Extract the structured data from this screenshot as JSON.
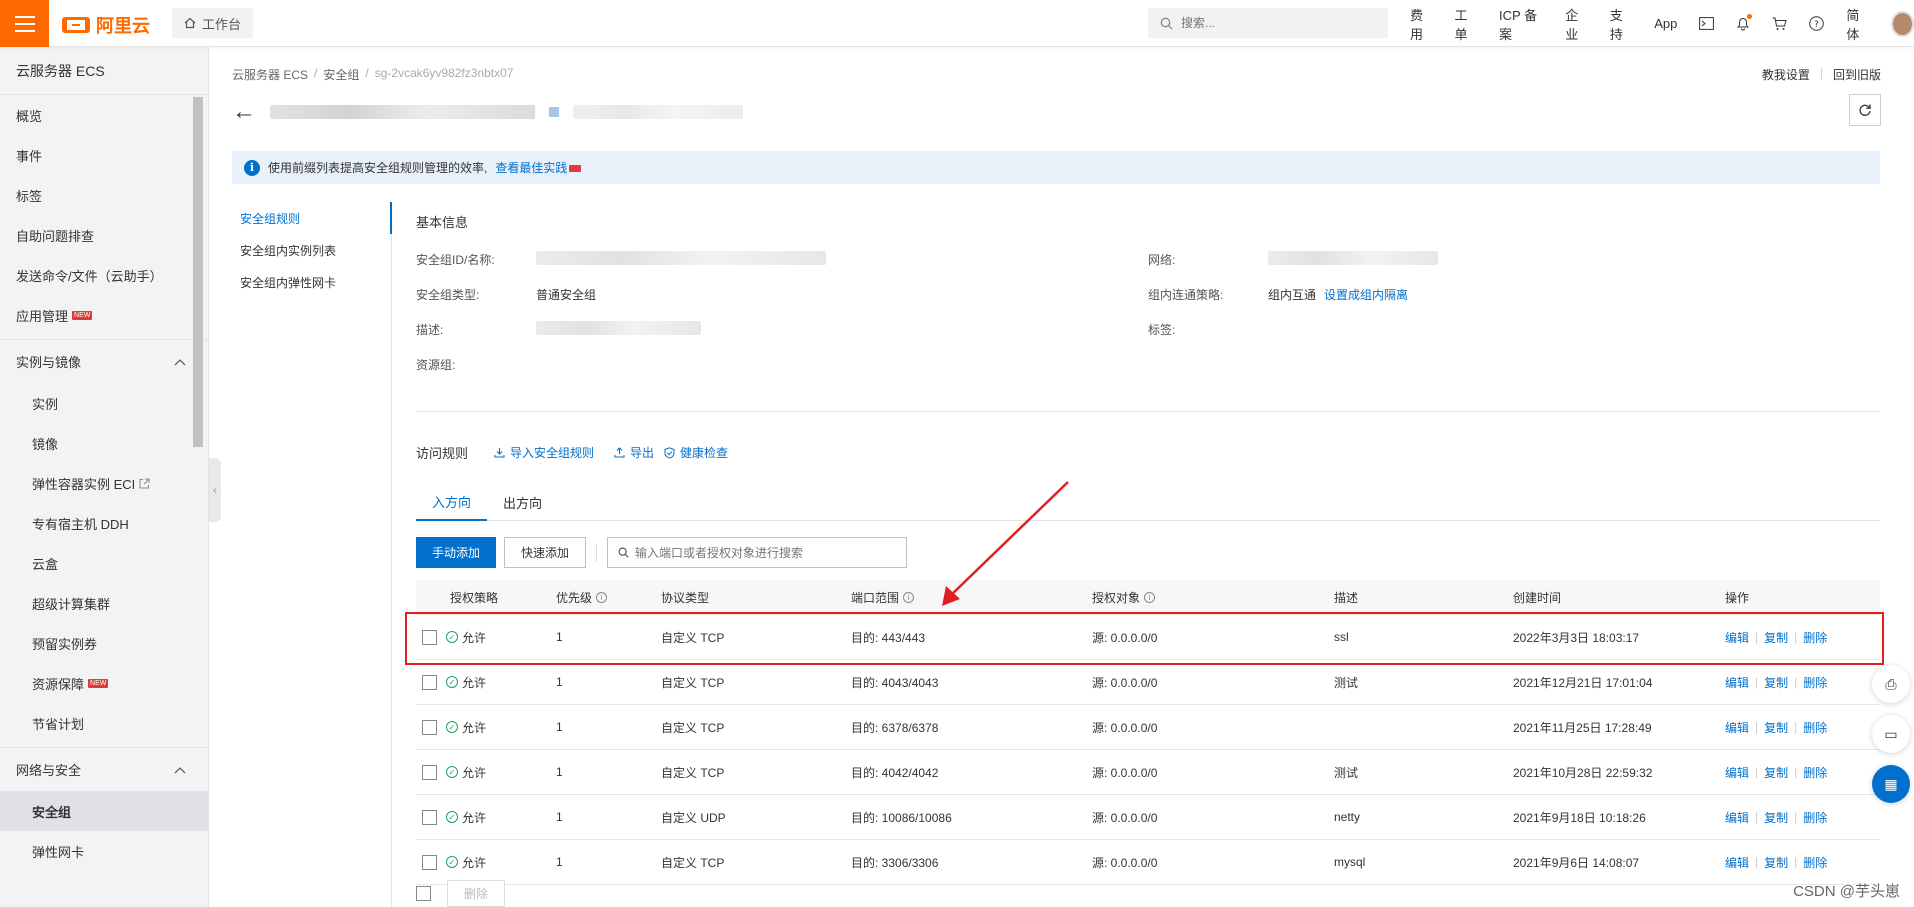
{
  "topbar": {
    "brand": "阿里云",
    "workbench": "工作台",
    "search_placeholder": "搜索...",
    "links": [
      "费用",
      "工单",
      "ICP 备案",
      "企业",
      "支持",
      "App"
    ],
    "lang": "简体"
  },
  "sidebar": {
    "title": "云服务器 ECS",
    "top_items": [
      "概览",
      "事件",
      "标签",
      "自助问题排查",
      "发送命令/文件（云助手）"
    ],
    "app_mgmt": "应用管理",
    "new_badge": "NEW",
    "group1": "实例与镜像",
    "group1_items": [
      "实例",
      "镜像",
      "弹性容器实例 ECI",
      "专有宿主机 DDH",
      "云盒",
      "超级计算集群",
      "预留实例券"
    ],
    "resource_guard": "资源保障",
    "saving_plan": "节省计划",
    "group2": "网络与安全",
    "group2_items": [
      "安全组",
      "弹性网卡"
    ]
  },
  "breadcrumb": {
    "items": [
      "云服务器 ECS",
      "安全组"
    ],
    "current": "sg-2vcak6yv982fz3nbtx07"
  },
  "header_links": [
    "教我设置",
    "回到旧版"
  ],
  "info_bar": {
    "text": "使用前缀列表提高安全组规则管理的效率,",
    "link": "查看最佳实践"
  },
  "subnav": [
    "安全组规则",
    "安全组内实例列表",
    "安全组内弹性网卡"
  ],
  "basic_info": {
    "title": "基本信息",
    "id_label": "安全组ID/名称:",
    "type_label": "安全组类型:",
    "type_value": "普通安全组",
    "desc_label": "描述:",
    "rg_label": "资源组:",
    "network_label": "网络:",
    "policy_label": "组内连通策略:",
    "policy_value": "组内互通",
    "policy_link": "设置成组内隔离",
    "tag_label": "标签:"
  },
  "rules": {
    "title": "访问规则",
    "import": "导入安全组规则",
    "export": "导出",
    "health": "健康检查"
  },
  "tabs": [
    "入方向",
    "出方向"
  ],
  "toolbar": {
    "manual_add": "手动添加",
    "quick_add": "快速添加",
    "search_placeholder": "输入端口或者授权对象进行搜索"
  },
  "table": {
    "headers": [
      "授权策略",
      "优先级",
      "协议类型",
      "端口范围",
      "授权对象",
      "描述",
      "创建时间",
      "操作"
    ],
    "rows": [
      {
        "policy": "允许",
        "priority": "1",
        "protocol": "自定义 TCP",
        "port": "目的: 443/443",
        "source": "源: 0.0.0.0/0",
        "desc": "ssl",
        "created": "2022年3月3日 18:03:17"
      },
      {
        "policy": "允许",
        "priority": "1",
        "protocol": "自定义 TCP",
        "port": "目的: 4043/4043",
        "source": "源: 0.0.0.0/0",
        "desc": "测试",
        "created": "2021年12月21日 17:01:04"
      },
      {
        "policy": "允许",
        "priority": "1",
        "protocol": "自定义 TCP",
        "port": "目的: 6378/6378",
        "source": "源: 0.0.0.0/0",
        "desc": "",
        "created": "2021年11月25日 17:28:49"
      },
      {
        "policy": "允许",
        "priority": "1",
        "protocol": "自定义 TCP",
        "port": "目的: 4042/4042",
        "source": "源: 0.0.0.0/0",
        "desc": "测试",
        "created": "2021年10月28日 22:59:32"
      },
      {
        "policy": "允许",
        "priority": "1",
        "protocol": "自定义 UDP",
        "port": "目的: 10086/10086",
        "source": "源: 0.0.0.0/0",
        "desc": "netty",
        "created": "2021年9月18日 10:18:26"
      },
      {
        "policy": "允许",
        "priority": "1",
        "protocol": "自定义 TCP",
        "port": "目的: 3306/3306",
        "source": "源: 0.0.0.0/0",
        "desc": "mysql",
        "created": "2021年9月6日 14:08:07"
      }
    ],
    "ops": [
      "编辑",
      "复制",
      "删除"
    ]
  },
  "bottom": {
    "delete": "删除"
  },
  "watermark": "CSDN @芋头崽",
  "colors": {
    "brand": "#ff6a00",
    "link": "#0070cc",
    "highlight": "#e02020",
    "allow": "#20a162"
  }
}
